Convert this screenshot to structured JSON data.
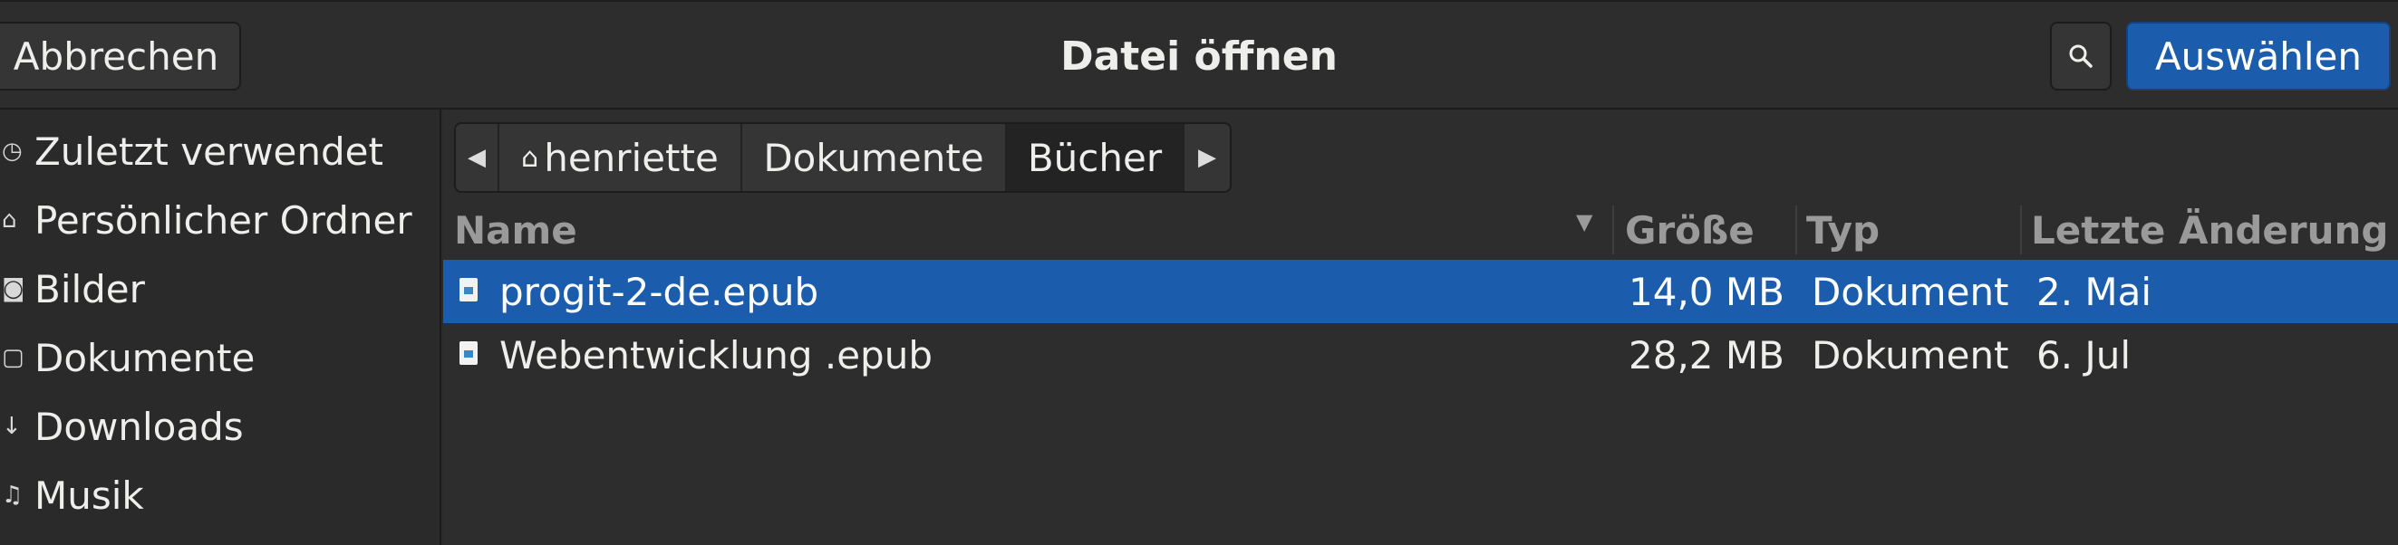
{
  "header": {
    "cancel_label": "Abbrechen",
    "title": "Datei öffnen",
    "search_icon": "search-icon",
    "select_label": "Auswählen"
  },
  "sidebar": {
    "items": [
      {
        "icon": "clock-icon",
        "glyph": "◷",
        "label": "Zuletzt verwendet"
      },
      {
        "icon": "home-icon",
        "glyph": "⌂",
        "label": "Persönlicher Ordner"
      },
      {
        "icon": "camera-icon",
        "glyph": "◙",
        "label": "Bilder"
      },
      {
        "icon": "document-icon",
        "glyph": "▢",
        "label": "Dokumente"
      },
      {
        "icon": "download-icon",
        "glyph": "↓",
        "label": "Downloads"
      },
      {
        "icon": "music-icon",
        "glyph": "♫",
        "label": "Musik"
      }
    ]
  },
  "pathbar": {
    "crumbs": [
      "henriette",
      "Dokumente",
      "Bücher"
    ]
  },
  "columns": {
    "name": "Name",
    "size": "Größe",
    "type": "Typ",
    "modified": "Letzte Änderung"
  },
  "files": [
    {
      "name": "progit-2-de.epub",
      "size": "14,0 MB",
      "type": "Dokument",
      "modified": "2. Mai",
      "selected": true
    },
    {
      "name": "Webentwicklung .epub",
      "size": "28,2 MB",
      "type": "Dokument",
      "modified": "6. Jul",
      "selected": false
    }
  ],
  "colors": {
    "accent": "#1b5cac",
    "background": "#2d2d2d"
  }
}
